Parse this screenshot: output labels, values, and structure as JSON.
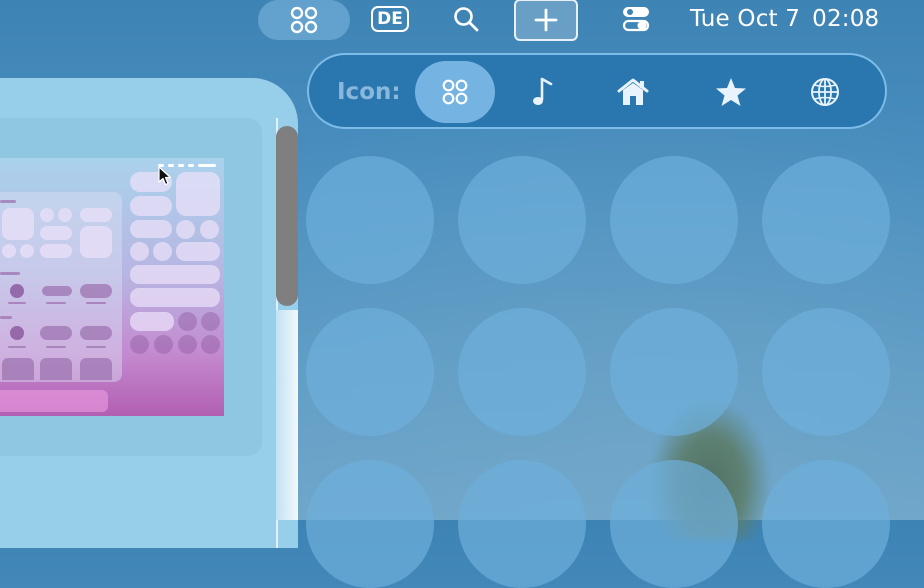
{
  "menubar": {
    "apps_icon": "four-dots-icon",
    "input_source": "DE",
    "search_icon": "magnifying-glass-icon",
    "add_icon": "plus-icon",
    "control_center_icon": "toggles-icon",
    "clock": {
      "date": "Tue Oct 7",
      "time": "02:08"
    }
  },
  "icon_picker": {
    "label": "Icon:",
    "options": [
      {
        "icon": "four-dots-icon",
        "selected": true
      },
      {
        "icon": "music-note-icon",
        "selected": false
      },
      {
        "icon": "house-icon",
        "selected": false
      },
      {
        "icon": "star-icon",
        "selected": false
      },
      {
        "icon": "globe-icon",
        "selected": false
      }
    ]
  },
  "grid": {
    "rows": 3,
    "columns": 4
  },
  "colors": {
    "picker_bg": "#2a77b0",
    "picker_selected": "#82bee b",
    "circle_fill": "#6eafdc",
    "preview_bg": "#97ceea"
  }
}
